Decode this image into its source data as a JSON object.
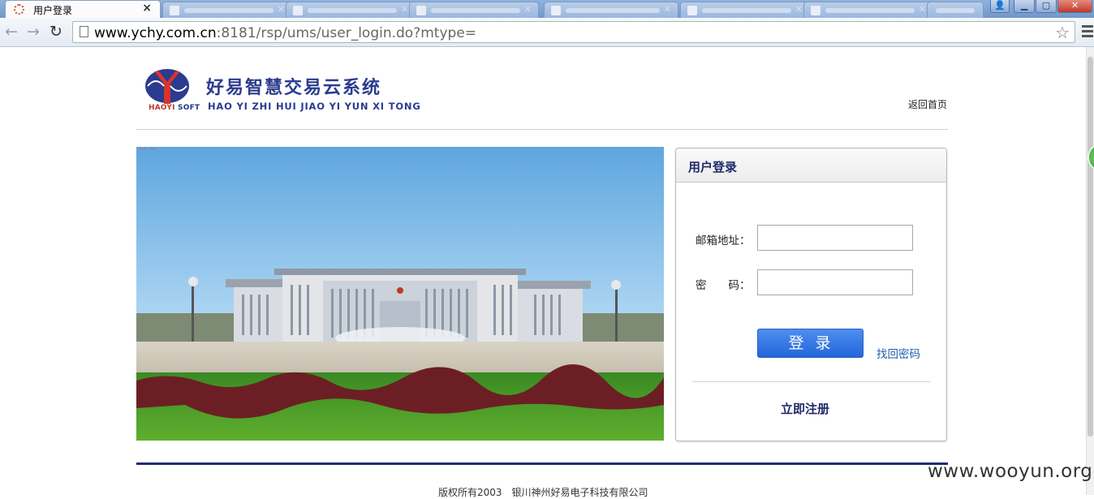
{
  "browser": {
    "active_tab": {
      "title": "用户登录",
      "close": "×"
    },
    "url": {
      "host": "www.ychy.com.cn",
      "rest": ":8181/rsp/ums/user_login.do?mtype="
    },
    "nav": {
      "back": "←",
      "forward": "→",
      "reload": "↻",
      "star": "☆"
    }
  },
  "header": {
    "brand_cn": "好易智慧交易云系统",
    "brand_en": "HAO YI ZHI HUI JIAO YI YUN XI TONG",
    "logo_sub_a": "HAOYI",
    "logo_sub_b": "SOFT",
    "home_link": "返回首页"
  },
  "login": {
    "title": "用户登录",
    "email_label": "邮箱地址：",
    "email_value": "",
    "password_label": "密　　码：",
    "password_value": "",
    "submit": "登录",
    "forgot": "找回密码",
    "register": "立即注册"
  },
  "footer": {
    "copyright": "版权所有2003　银川神州好易电子科技有限公司",
    "watermark": "www.wooyun.org"
  },
  "colors": {
    "brand_navy": "#2b3b8f",
    "button_blue": "#2266d9",
    "logo_red": "#c0392b",
    "tabbar_blue": "#6f97c9"
  }
}
